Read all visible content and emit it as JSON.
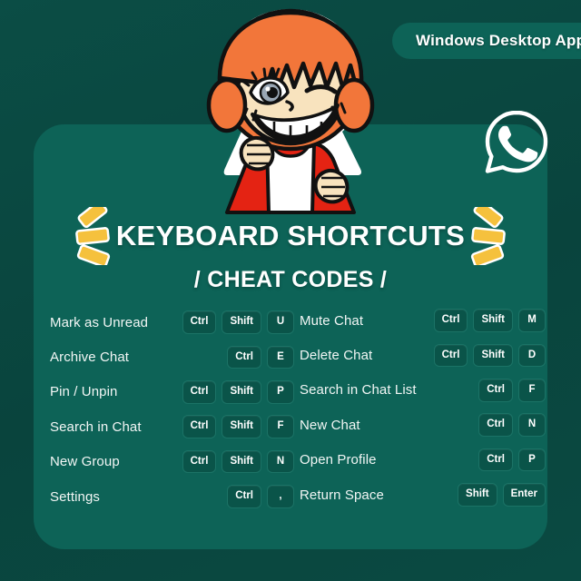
{
  "badge": {
    "label": "Windows Desktop App"
  },
  "logo": {
    "name": "whatsapp-logo"
  },
  "title": {
    "line1": "KEYBOARD SHORTCUTS",
    "line2": "/ CHEAT CODES /"
  },
  "colors": {
    "background": "#0a4a42",
    "card": "#0d6357",
    "key_fill": "#0a5449",
    "key_border": "#1b7366",
    "text": "#ffffff",
    "accent_yellow": "#F5C13D",
    "hair_orange": "#F2763A",
    "shirt_red": "#E42313",
    "skin": "#F8E3BE"
  },
  "shortcuts": {
    "left": [
      {
        "label": "Mark as Unread",
        "keys": [
          "Ctrl",
          "Shift",
          "U"
        ]
      },
      {
        "label": "Archive Chat",
        "keys": [
          "Ctrl",
          "E"
        ]
      },
      {
        "label": "Pin / Unpin",
        "keys": [
          "Ctrl",
          "Shift",
          "P"
        ]
      },
      {
        "label": "Search in Chat",
        "keys": [
          "Ctrl",
          "Shift",
          "F"
        ]
      },
      {
        "label": "New Group",
        "keys": [
          "Ctrl",
          "Shift",
          "N"
        ]
      },
      {
        "label": "Settings",
        "keys": [
          "Ctrl",
          ","
        ]
      }
    ],
    "right": [
      {
        "label": "Mute Chat",
        "keys": [
          "Ctrl",
          "Shift",
          "M"
        ]
      },
      {
        "label": "Delete Chat",
        "keys": [
          "Ctrl",
          "Shift",
          "D"
        ]
      },
      {
        "label": "Search in Chat List",
        "keys": [
          "Ctrl",
          "F"
        ]
      },
      {
        "label": "New Chat",
        "keys": [
          "Ctrl",
          "N"
        ]
      },
      {
        "label": "Open Profile",
        "keys": [
          "Ctrl",
          "P"
        ]
      },
      {
        "label": "Return Space",
        "keys": [
          "Shift",
          "Enter"
        ]
      }
    ]
  }
}
